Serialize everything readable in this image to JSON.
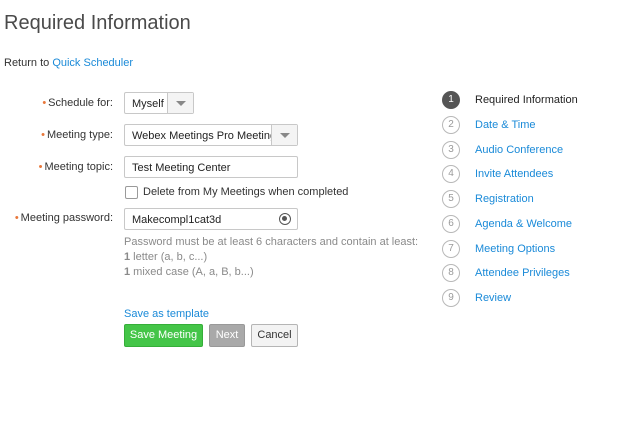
{
  "page": {
    "title": "Required Information",
    "return_prefix": "Return to ",
    "return_link": "Quick Scheduler"
  },
  "form": {
    "required_marker": "•",
    "schedule_for": {
      "label": "Schedule for:",
      "value": "Myself"
    },
    "meeting_type": {
      "label": "Meeting type:",
      "value": "Webex Meetings Pro Meeting"
    },
    "meeting_topic": {
      "label": "Meeting topic:",
      "value": "Test Meeting Center"
    },
    "delete_checkbox": {
      "label": "Delete from My Meetings when completed",
      "checked": false
    },
    "meeting_password": {
      "label": "Meeting password:",
      "value": "Makecompl1cat3d"
    },
    "password_hint": {
      "line1": "Password must be at least 6 characters and contain at least:",
      "line2_bold": "1",
      "line2_rest": " letter (a, b, c...)",
      "line3_bold": "1",
      "line3_rest": " mixed case (A, a, B, b...)"
    },
    "save_template_link": "Save as template",
    "buttons": {
      "save": "Save Meeting",
      "next": "Next",
      "cancel": "Cancel"
    }
  },
  "steps": [
    {
      "num": "1",
      "label": "Required Information"
    },
    {
      "num": "2",
      "label": "Date & Time"
    },
    {
      "num": "3",
      "label": "Audio Conference"
    },
    {
      "num": "4",
      "label": "Invite Attendees"
    },
    {
      "num": "5",
      "label": "Registration"
    },
    {
      "num": "6",
      "label": "Agenda & Welcome"
    },
    {
      "num": "7",
      "label": "Meeting Options"
    },
    {
      "num": "8",
      "label": "Attendee Privileges"
    },
    {
      "num": "9",
      "label": "Review"
    }
  ],
  "colors": {
    "link": "#1a8ad8",
    "required_marker": "#e8773a",
    "primary_button": "#44c548",
    "active_step": "#555555"
  }
}
